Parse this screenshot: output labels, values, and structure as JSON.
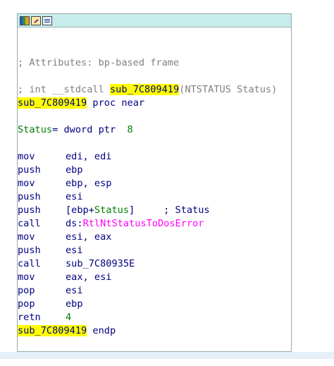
{
  "window": {
    "toolbar_icons": [
      "graph-view-icon",
      "edit-icon",
      "text-view-icon"
    ]
  },
  "listing": {
    "attr_comment": "; Attributes: bp-based frame",
    "proto_prefix": "; int __stdcall ",
    "proto_name": "sub_7C809419",
    "proto_suffix": "(NTSTATUS Status)",
    "proc_name": "sub_7C809419",
    "proc_keyword": " proc near",
    "var_name": "Status",
    "var_def": "= dword ptr  ",
    "var_offset": "8",
    "instructions": [
      {
        "mn": "mov",
        "op": "edi, edi"
      },
      {
        "mn": "push",
        "op": "ebp"
      },
      {
        "mn": "mov",
        "op": "ebp, esp"
      },
      {
        "mn": "push",
        "op": "esi"
      },
      {
        "mn": "push",
        "op_pre": "[ebp+",
        "op_var": "Status",
        "op_post": "]     ",
        "op_cmt": "; Status"
      },
      {
        "mn": "call",
        "op_pre": "ds:",
        "op_api": "RtlNtStatusToDosError"
      },
      {
        "mn": "mov",
        "op": "esi, eax"
      },
      {
        "mn": "push",
        "op": "esi"
      },
      {
        "mn": "call",
        "op": "sub_7C80935E"
      },
      {
        "mn": "mov",
        "op": "eax, esi"
      },
      {
        "mn": "pop",
        "op": "esi"
      },
      {
        "mn": "pop",
        "op": "ebp"
      },
      {
        "mn": "retn",
        "op_num": "4"
      }
    ],
    "endp_name": "sub_7C809419",
    "endp_keyword": " endp"
  }
}
